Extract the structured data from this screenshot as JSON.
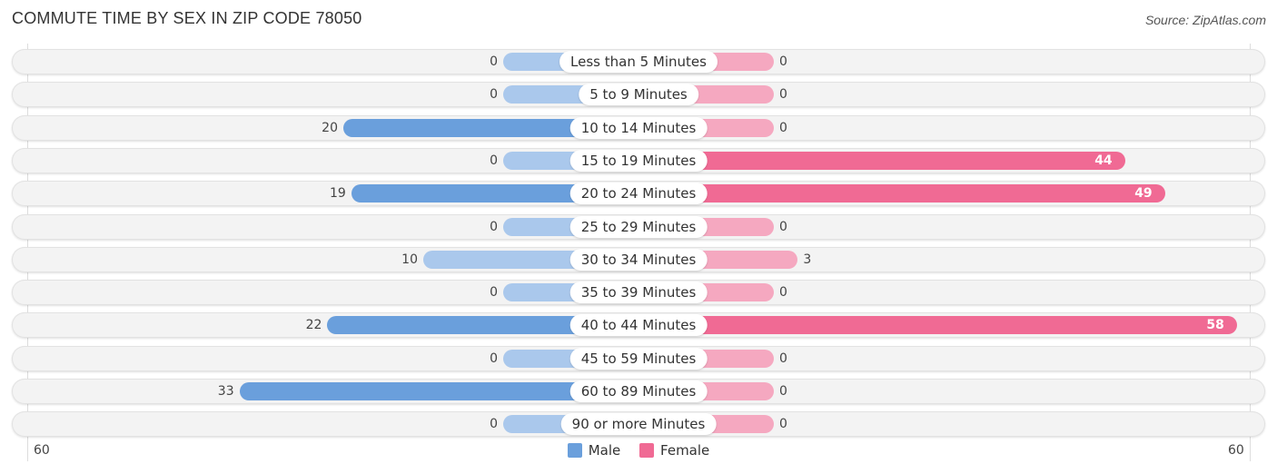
{
  "header": {
    "title": "COMMUTE TIME BY SEX IN ZIP CODE 78050",
    "source": "Source: ZipAtlas.com"
  },
  "colors": {
    "male": "#6a9fdc",
    "male_light": "#aac8ec",
    "female": "#f06a94",
    "female_light": "#f5a8c0",
    "row_bg": "#f3f3f3"
  },
  "chart_data": {
    "type": "bar",
    "orientation": "horizontal-diverging",
    "title": "COMMUTE TIME BY SEX IN ZIP CODE 78050",
    "categories": [
      "Less than 5 Minutes",
      "5 to 9 Minutes",
      "10 to 14 Minutes",
      "15 to 19 Minutes",
      "20 to 24 Minutes",
      "25 to 29 Minutes",
      "30 to 34 Minutes",
      "35 to 39 Minutes",
      "40 to 44 Minutes",
      "45 to 59 Minutes",
      "60 to 89 Minutes",
      "90 or more Minutes"
    ],
    "series": [
      {
        "name": "Male",
        "values": [
          0,
          0,
          20,
          0,
          19,
          0,
          10,
          0,
          22,
          0,
          33,
          0
        ]
      },
      {
        "name": "Female",
        "values": [
          0,
          0,
          0,
          44,
          49,
          0,
          3,
          0,
          58,
          0,
          0,
          0
        ]
      }
    ],
    "axis": {
      "left_label": "60",
      "right_label": "60",
      "range": [
        60,
        60
      ]
    },
    "legend": {
      "position": "bottom-center",
      "entries": [
        "Male",
        "Female"
      ]
    }
  }
}
